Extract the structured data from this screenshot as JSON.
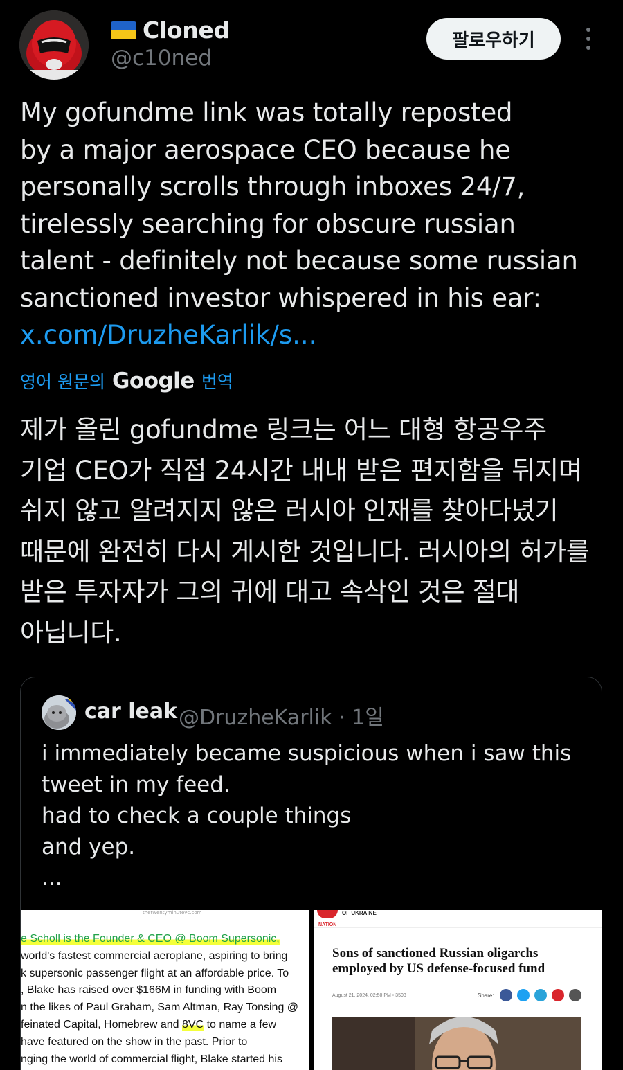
{
  "author": {
    "name": "Cloned",
    "handle": "@c10ned",
    "flag_icon": "ukraine-flag-icon"
  },
  "actions": {
    "follow_label": "팔로우하기",
    "more_icon": "more-vertical-icon"
  },
  "tweet": {
    "text": "My gofundme link was totally reposted\nby a major aerospace CEO because he\npersonally scrolls through inboxes 24/7,\ntirelessly searching for obscure russian\ntalent - definitely not because some russian\nsanctioned investor whispered in his ear:",
    "link": "x.com/DruzheKarlik/s..."
  },
  "translation": {
    "prefix": "영어 원문의",
    "provider": "Google",
    "suffix": "번역",
    "text": "제가 올린 gofundme 링크는 어느 대형 항공우주\n기업 CEO가 직접 24시간 내내 받은 편지함을 뒤지며\n쉬지 않고 알려지지 않은 러시아 인재를 찾아다녔기\n때문에 완전히 다시 게시한 것입니다. 러시아의 허가를\n받은 투자자가 그의 귀에 대고 속삭인 것은 절대\n아닙니다."
  },
  "quote": {
    "name": "car leak",
    "handle_time": "@DruzheKarlik · 1일",
    "text": "i immediately became suspicious when i saw this\ntweet in my feed.\nhad to check a couple things\nand yep.\n..."
  },
  "media_left": {
    "url": "thetwentyminutevc.com",
    "line1_a": "e Scholl is the Founder & CEO @ ",
    "line1_b": "Boom Supersonic,",
    "line2": "world's fastest commercial aeroplane, aspiring to bring",
    "line3": "k supersonic passenger flight at an affordable price. To",
    "line4": ", Blake has raised over $166M in funding with Boom",
    "line5": "n the likes of Paul Graham, Sam Altman, Ray Tonsing @",
    "line6_a": "feinated Capital, Homebrew and ",
    "line6_b": "8VC",
    "line6_c": " to name a few",
    "line7": "have featured on the show in the past. Prior to",
    "line8": "nging the world of commercial flight, Blake started his"
  },
  "media_right": {
    "outlet": "OF UKRAINE",
    "section": "NATION",
    "headline": "Sons of sanctioned Russian oligarchs\nemployed by US defense-focused fund",
    "meta": "August 21, 2024, 02:50 PM  • 3503",
    "share_label": "Share:",
    "share_colors": [
      "#3b5998",
      "#1da1f2",
      "#2aa3d9",
      "#d9262c",
      "#555555"
    ]
  }
}
